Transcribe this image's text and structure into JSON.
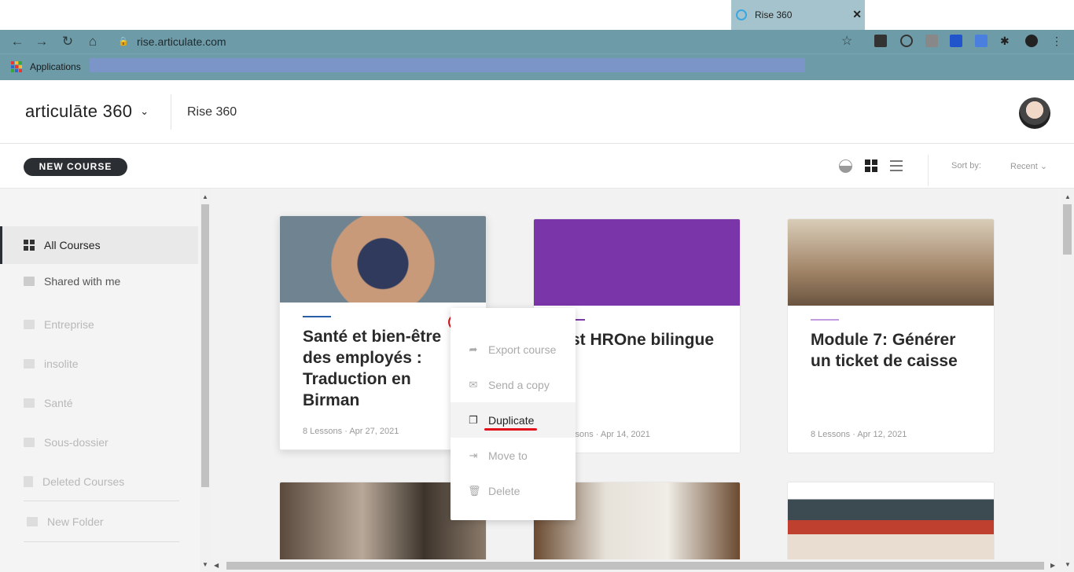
{
  "browser": {
    "tab_title": "Rise 360",
    "tab_close": "✕",
    "url": "rise.articulate.com",
    "bookmarks_apps_label": "Applications"
  },
  "app": {
    "logo_text": "articulāte 360",
    "product_name": "Rise 360"
  },
  "actionbar": {
    "new_course_label": "NEW COURSE",
    "sort_label": "Sort by:",
    "sort_value": "Recent"
  },
  "sidebar": {
    "items": [
      {
        "label": "All Courses"
      },
      {
        "label": "Shared with me"
      },
      {
        "label": "Entreprise"
      },
      {
        "label": "insolite"
      },
      {
        "label": "Santé"
      },
      {
        "label": "Sous-dossier"
      },
      {
        "label": "Deleted Courses"
      },
      {
        "label": "New Folder"
      }
    ]
  },
  "courses": [
    {
      "title": "Santé et bien-être des employés : Traduction en Birman",
      "meta": "8 Lessons · Apr 27, 2021",
      "accent": "#2a5fa8"
    },
    {
      "title": "st HROne bilingue",
      "meta": "ssons · Apr 14, 2021",
      "accent": "#7d3aa8"
    },
    {
      "title": "Module 7: Générer un ticket de caisse",
      "meta": "8 Lessons · Apr 12, 2021",
      "accent": "#c39be0"
    }
  ],
  "context_menu": {
    "more_label": "•••",
    "items": [
      {
        "label": "Export course",
        "icon": "share-icon"
      },
      {
        "label": "Send a copy",
        "icon": "mail-icon"
      },
      {
        "label": "Duplicate",
        "icon": "copy-icon"
      },
      {
        "label": "Move to",
        "icon": "move-icon"
      },
      {
        "label": "Delete",
        "icon": "trash-icon"
      }
    ]
  }
}
